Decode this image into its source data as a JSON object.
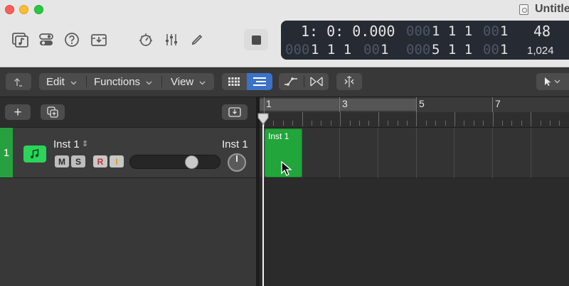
{
  "window": {
    "title": "Untitle"
  },
  "lcd": {
    "position": "1:  0:  0.000",
    "pos_dim_1": "000",
    "pos_val_1": "1  1  1",
    "pos_dim_2": "00",
    "pos_val_2": "1",
    "tempo": "48",
    "bottom_dim_1": "000",
    "bottom_val_1": "1  1  1",
    "bottom_dim_2": "00",
    "bottom_val_2": "1",
    "bottom_dim_3": "000",
    "bottom_val_3": "5  1  1",
    "bottom_dim_4": "00",
    "bottom_val_4": "1",
    "division": "1,024"
  },
  "menus": {
    "edit": "Edit",
    "functions": "Functions",
    "view": "View"
  },
  "ruler": {
    "bars": [
      "1",
      "3",
      "5",
      "7"
    ]
  },
  "track": {
    "number": "1",
    "name": "Inst 1",
    "mute_label": "M",
    "solo_label": "S",
    "record_label": "R",
    "input_label": "I",
    "channel_label": "Inst 1",
    "volume_level": 0.72
  },
  "region": {
    "name": "Inst 1"
  },
  "icons": {
    "add_track": "+",
    "chevron": "⌄",
    "updown": "⇕"
  },
  "colors": {
    "track_green": "#27a13f",
    "region_green": "#22a53b",
    "accent_blue": "#3b72c8"
  }
}
